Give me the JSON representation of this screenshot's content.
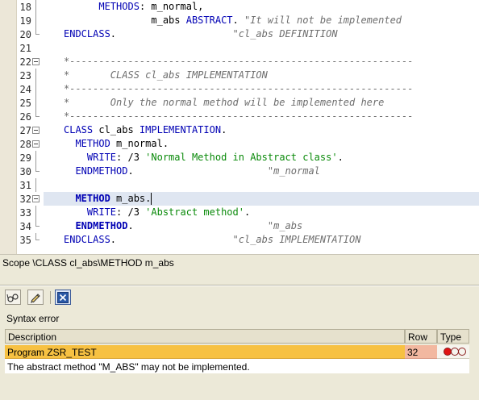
{
  "editor": {
    "lines": [
      {
        "n": "18",
        "segs": [
          {
            "t": "      "
          },
          {
            "t": "METHODS",
            "c": "kw"
          },
          {
            "t": ": m_normal,"
          }
        ]
      },
      {
        "n": "19",
        "segs": [
          {
            "t": "               m_abs "
          },
          {
            "t": "ABSTRACT",
            "c": "kw"
          },
          {
            "t": ". "
          },
          {
            "t": "\"It will not be implemented",
            "c": "cm"
          }
        ]
      },
      {
        "n": "20",
        "segs": [
          {
            "t": "ENDCLASS",
            "c": "kw"
          },
          {
            "t": ".                    "
          },
          {
            "t": "\"cl_abs DEFINITION",
            "c": "cm"
          }
        ]
      },
      {
        "n": "21",
        "segs": []
      },
      {
        "n": "22",
        "segs": [
          {
            "t": "*-----------------------------------------------------------",
            "c": "cm"
          }
        ]
      },
      {
        "n": "23",
        "segs": [
          {
            "t": "*       CLASS cl_abs IMPLEMENTATION",
            "c": "cm"
          }
        ]
      },
      {
        "n": "24",
        "segs": [
          {
            "t": "*-----------------------------------------------------------",
            "c": "cm"
          }
        ]
      },
      {
        "n": "25",
        "segs": [
          {
            "t": "*       Only the normal method will be implemented here",
            "c": "cm"
          }
        ]
      },
      {
        "n": "26",
        "segs": [
          {
            "t": "*-----------------------------------------------------------",
            "c": "cm"
          }
        ]
      },
      {
        "n": "27",
        "segs": [
          {
            "t": "CLASS",
            "c": "kw"
          },
          {
            "t": " cl_abs "
          },
          {
            "t": "IMPLEMENTATION",
            "c": "kw"
          },
          {
            "t": "."
          }
        ]
      },
      {
        "n": "28",
        "segs": [
          {
            "t": "  "
          },
          {
            "t": "METHOD",
            "c": "kw"
          },
          {
            "t": " m_normal."
          }
        ]
      },
      {
        "n": "29",
        "segs": [
          {
            "t": "    "
          },
          {
            "t": "WRITE",
            "c": "kw"
          },
          {
            "t": ": /3 "
          },
          {
            "t": "'Normal Method in Abstract class'",
            "c": "str"
          },
          {
            "t": "."
          }
        ]
      },
      {
        "n": "30",
        "segs": [
          {
            "t": "  "
          },
          {
            "t": "ENDMETHOD",
            "c": "kw"
          },
          {
            "t": ".                       "
          },
          {
            "t": "\"m_normal",
            "c": "cm"
          }
        ]
      },
      {
        "n": "31",
        "segs": []
      },
      {
        "n": "32",
        "segs": [
          {
            "t": "  "
          },
          {
            "t": "METHOD",
            "c": "kwb"
          },
          {
            "t": " m_abs."
          }
        ],
        "current": true
      },
      {
        "n": "33",
        "segs": [
          {
            "t": "    "
          },
          {
            "t": "WRITE",
            "c": "kw"
          },
          {
            "t": ": /3 "
          },
          {
            "t": "'Abstract method'",
            "c": "str"
          },
          {
            "t": "."
          }
        ]
      },
      {
        "n": "34",
        "segs": [
          {
            "t": "  "
          },
          {
            "t": "ENDMETHOD",
            "c": "kwb"
          },
          {
            "t": ".                       "
          },
          {
            "t": "\"m_abs",
            "c": "cm"
          }
        ]
      },
      {
        "n": "35",
        "segs": [
          {
            "t": "ENDCLASS",
            "c": "kw"
          },
          {
            "t": ".                    "
          },
          {
            "t": "\"cl_abs IMPLEMENTATION",
            "c": "cm"
          }
        ]
      }
    ]
  },
  "scope_bar": {
    "text": "Scope \\CLASS cl_abs\\METHOD m_abs"
  },
  "toolbar": {
    "buttons": [
      {
        "name": "glasses-icon"
      },
      {
        "name": "pencil-icon"
      },
      {
        "name": "close-icon"
      }
    ]
  },
  "panel": {
    "title": "Syntax error",
    "columns": {
      "description": "Description",
      "row": "Row",
      "type": "Type"
    },
    "error": {
      "program": "Program ZSR_TEST",
      "row": "32",
      "message": "The abstract method \"M_ABS\" may not be implemented."
    }
  },
  "colors": {
    "keyword": "#0000b4",
    "string": "#0a8a0a",
    "comment": "#6e6e6e",
    "error_row": "#f7c142",
    "error_row_cell": "#f2b8a0",
    "lamp_red": "#e01414"
  }
}
